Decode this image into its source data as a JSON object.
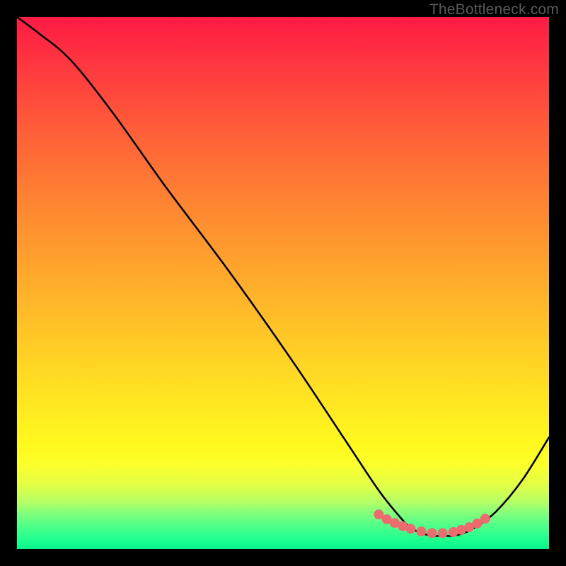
{
  "watermark": "TheBottleneck.com",
  "chart_data": {
    "type": "line",
    "title": "",
    "xlabel": "",
    "ylabel": "",
    "xlim": [
      0,
      100
    ],
    "ylim": [
      0,
      100
    ],
    "series": [
      {
        "name": "main-curve",
        "x": [
          0,
          4,
          10,
          18,
          28,
          40,
          52,
          62,
          68,
          72,
          74,
          76,
          78,
          80,
          82,
          84,
          86,
          90,
          95,
          100
        ],
        "y": [
          100,
          97,
          92,
          82,
          68,
          52,
          35,
          20,
          11,
          6,
          4,
          3,
          2.5,
          2.5,
          2.5,
          3,
          4,
          7,
          13,
          21
        ]
      },
      {
        "name": "highlight-dots",
        "x": [
          68,
          69.5,
          71,
          72.5,
          74,
          76,
          78,
          80,
          82,
          83.5,
          85,
          86.5,
          88
        ],
        "y": [
          6.5,
          5.6,
          4.9,
          4.3,
          3.8,
          3.3,
          3.0,
          3.0,
          3.2,
          3.6,
          4.1,
          4.8,
          5.7
        ]
      }
    ],
    "highlight_color": "#ed6a6f",
    "curve_color": "#000000",
    "grid": false,
    "legend": false
  }
}
